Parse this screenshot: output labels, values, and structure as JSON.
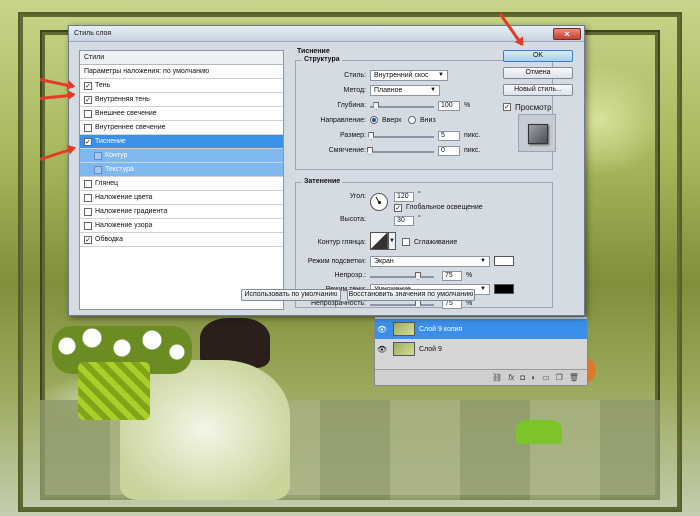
{
  "dialog": {
    "title": "Стиль слоя",
    "close_label": "×",
    "styles_header": "Стили",
    "blending_defaults": "Параметры наложения: по умолчанию",
    "styles": [
      {
        "label": "Тень",
        "checked": true
      },
      {
        "label": "Внутренняя тень",
        "checked": true
      },
      {
        "label": "Внешнее свечение",
        "checked": false
      },
      {
        "label": "Внутреннее свечение",
        "checked": false
      },
      {
        "label": "Тиснение",
        "checked": true,
        "selected": true
      },
      {
        "label": "Контур",
        "sub": true
      },
      {
        "label": "Текстура",
        "sub": true
      },
      {
        "label": "Глянец",
        "checked": false
      },
      {
        "label": "Наложение цвета",
        "checked": false
      },
      {
        "label": "Наложение градиента",
        "checked": false
      },
      {
        "label": "Наложение узора",
        "checked": false
      },
      {
        "label": "Обводка",
        "checked": true
      }
    ],
    "section_title": "Тиснение",
    "structure": {
      "label": "Структура",
      "style_label": "Стиль:",
      "style_value": "Внутренний скос",
      "technique_label": "Метод:",
      "technique_value": "Плавное",
      "depth_label": "Глубина:",
      "depth_value": "100",
      "depth_unit": "%",
      "depth_level": 0.1,
      "direction_label": "Направление:",
      "direction_up": "Вверх",
      "direction_down": "Вниз",
      "size_label": "Размер:",
      "size_value": "5",
      "size_unit": "пикс.",
      "size_level": 0.02,
      "soften_label": "Смягчение:",
      "soften_value": "0",
      "soften_unit": "пикс.",
      "soften_level": 0.0
    },
    "shading": {
      "label": "Затенение",
      "angle_label": "Угол:",
      "angle_value": "120",
      "angle_unit": "°",
      "global_light_label": "Глобальное освещение",
      "global_light_checked": true,
      "altitude_label": "Высота:",
      "altitude_value": "30",
      "altitude_unit": "°",
      "gloss_contour_label": "Контур глянца:",
      "antialias_label": "Сглаживание",
      "antialias_checked": false,
      "highlight_mode_label": "Режим подсветки:",
      "highlight_mode_value": "Экран",
      "highlight_color": "#ffffff",
      "highlight_opacity_label": "Непрозр.:",
      "highlight_opacity_value": "75",
      "highlight_opacity_unit": "%",
      "highlight_opacity_level": 0.75,
      "shadow_mode_label": "Режим тени:",
      "shadow_mode_value": "Умножение",
      "shadow_color": "#000000",
      "shadow_opacity_label": "Непрозрачность:",
      "shadow_opacity_value": "75",
      "shadow_opacity_unit": "%",
      "shadow_opacity_level": 0.75
    },
    "make_default_label": "Использовать по умолчанию",
    "reset_default_label": "Восстановить значения по умолчанию",
    "ok_label": "OK",
    "cancel_label": "Отмена",
    "new_style_label": "Новый стиль...",
    "preview_label": "Просмотр",
    "preview_checked": true
  },
  "layers": {
    "rows": [
      {
        "name": "Слой 9 копия",
        "selected": true
      },
      {
        "name": "Слой 9",
        "selected": false
      }
    ],
    "tool_icons": [
      "link-icon",
      "fx-icon",
      "mask-icon",
      "adjustment-icon",
      "folder-icon",
      "new-layer-icon",
      "trash-icon"
    ]
  }
}
